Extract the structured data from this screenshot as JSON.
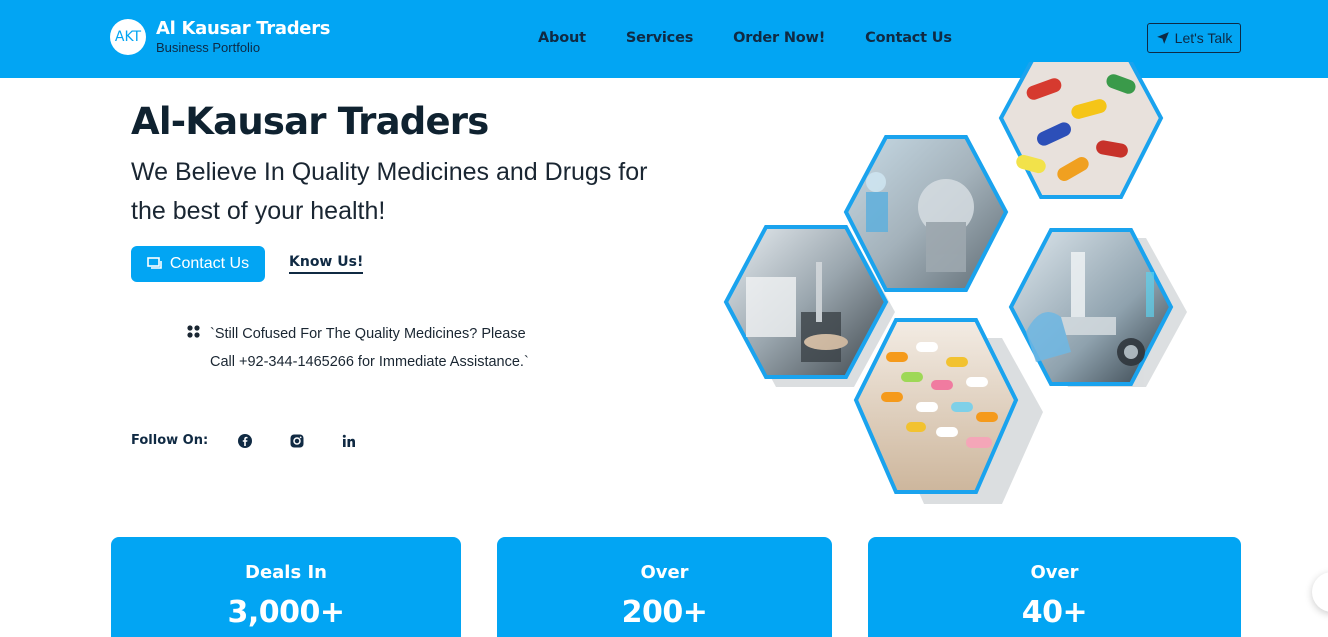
{
  "header": {
    "logo_text": "AKT",
    "brand_title": "Al Kausar Traders",
    "brand_subtitle": "Business Portfolio",
    "nav": [
      "About",
      "Services",
      "Order Now!",
      "Contact Us"
    ],
    "cta": "Let's Talk"
  },
  "hero": {
    "title": "Al-Kausar Traders",
    "subtitle": "We Believe In Quality Medicines and Drugs for the best of your health!",
    "contact_button": "Contact Us",
    "know_link": "Know Us!",
    "notice_line1": "`Still Cofused For The Quality Medicines? Please",
    "notice_line2": "Call +92-344-1465266 for Immediate Assistance.`"
  },
  "follow": {
    "label": "Follow On:",
    "icons": [
      "facebook-icon",
      "instagram-icon",
      "linkedin-icon"
    ]
  },
  "stats": [
    {
      "label": "Deals In",
      "value": "3,000+"
    },
    {
      "label": "Over",
      "value": "200+"
    },
    {
      "label": "Over",
      "value": "40+"
    }
  ],
  "colors": {
    "accent": "#02a5f3",
    "text_dark": "#0f2230",
    "nav_text": "#102a43"
  }
}
